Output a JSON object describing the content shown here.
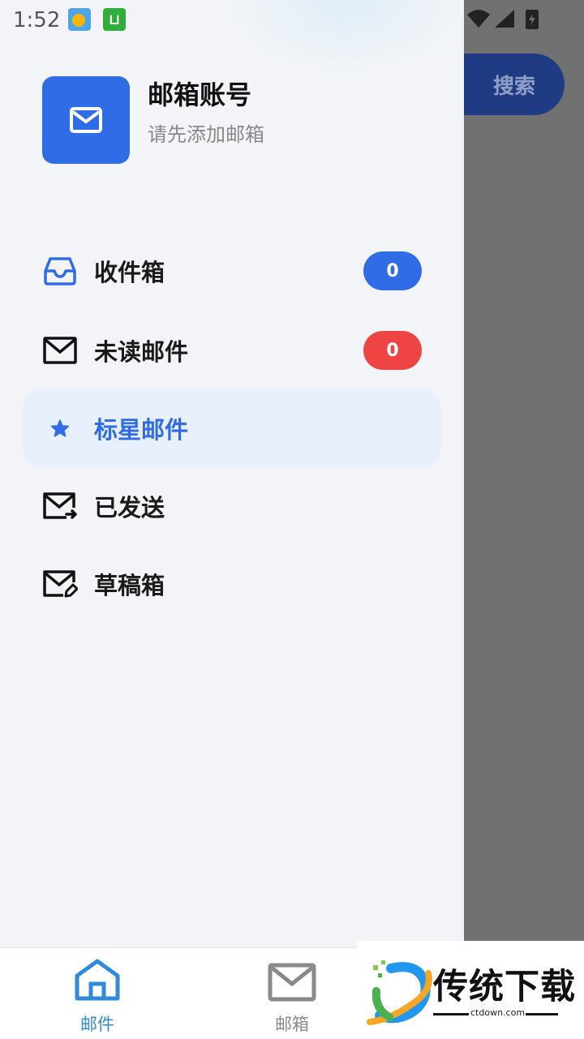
{
  "status_bar": {
    "time": "1:52",
    "app_icon_2_letter": "⊔"
  },
  "top_right": {
    "search_label": "搜索"
  },
  "account": {
    "title": "邮箱账号",
    "subtitle": "请先添加邮箱",
    "icon": "mail-icon"
  },
  "nav": {
    "items": [
      {
        "label": "收件箱",
        "icon": "inbox-icon",
        "badge": "0",
        "badge_color": "#2f6ce6"
      },
      {
        "label": "未读邮件",
        "icon": "mail-icon",
        "badge": "0",
        "badge_color": "#ef4444"
      },
      {
        "label": "标星邮件",
        "icon": "star-icon",
        "active": true
      },
      {
        "label": "已发送",
        "icon": "mail-send-icon"
      },
      {
        "label": "草稿箱",
        "icon": "mail-edit-icon"
      }
    ]
  },
  "bottom_nav": {
    "tabs": [
      {
        "label": "邮件",
        "icon": "home-icon",
        "active": true,
        "color": "#2f8bd9"
      },
      {
        "label": "邮箱",
        "icon": "mail-icon",
        "active": false,
        "color": "#8a8a8a"
      }
    ]
  },
  "watermark": {
    "text": "传统下载",
    "url": "ctdown.com"
  },
  "colors": {
    "accent": "#2f6ce6",
    "active_bg": "#e8effd",
    "danger": "#ef4444",
    "scrim": "#717171"
  }
}
